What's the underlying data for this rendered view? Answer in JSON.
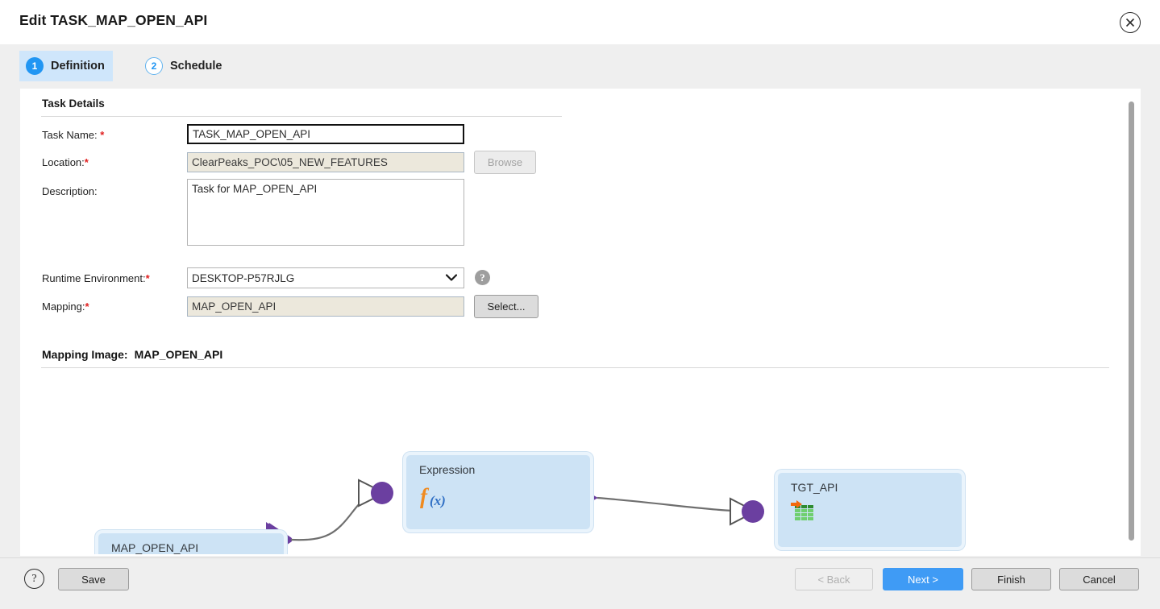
{
  "dialog": {
    "title": "Edit TASK_MAP_OPEN_API",
    "close_icon": "close-icon"
  },
  "tabs": [
    {
      "number": "1",
      "label": "Definition",
      "active": true
    },
    {
      "number": "2",
      "label": "Schedule",
      "active": false
    }
  ],
  "task_details": {
    "section_title": "Task Details",
    "fields": {
      "task_name": {
        "label": "Task Name:",
        "required": "*",
        "value": "TASK_MAP_OPEN_API",
        "placeholder": ""
      },
      "location": {
        "label": "Location:",
        "required": "*",
        "value": "ClearPeaks_POC\\05_NEW_FEATURES",
        "button_label": "Browse"
      },
      "description": {
        "label": "Description:",
        "required": "",
        "value": "Task for MAP_OPEN_API",
        "placeholder": ""
      },
      "runtime_environment": {
        "label": "Runtime Environment:",
        "required": "*",
        "value": "DESKTOP-P57RJLG",
        "options": [
          "DESKTOP-P57RJLG"
        ],
        "help_icon": "help-icon",
        "help_glyph": "?"
      },
      "mapping": {
        "label": "Mapping:",
        "required": "*",
        "value": "MAP_OPEN_API",
        "button_label": "Select..."
      }
    }
  },
  "mapping_image": {
    "header_label": "Mapping Image:",
    "mapping_name": "MAP_OPEN_API",
    "nodes": [
      {
        "id": "source",
        "label": "MAP_OPEN_API",
        "icon": "source-table-icon"
      },
      {
        "id": "expression",
        "label": "Expression",
        "icon": "function-fx-icon"
      },
      {
        "id": "target",
        "label": "TGT_API",
        "icon": "target-table-icon"
      }
    ],
    "colors": {
      "node_fill": "#cde3f5",
      "node_halo": "#eaf4fc",
      "port_purple": "#6b3fa0",
      "link_gray": "#6f6f6f",
      "fx_orange": "#f08a1e",
      "fx_blue": "#2f6fc4",
      "grid_green": "#4fb84f",
      "arrow_blue": "#1f6fd0",
      "arrow_orange": "#f2690d"
    }
  },
  "footer": {
    "help_glyph": "?",
    "save_label": "Save",
    "back_label": "< Back",
    "next_label": "Next >",
    "finish_label": "Finish",
    "cancel_label": "Cancel",
    "accent_color": "#3f9bf5"
  }
}
